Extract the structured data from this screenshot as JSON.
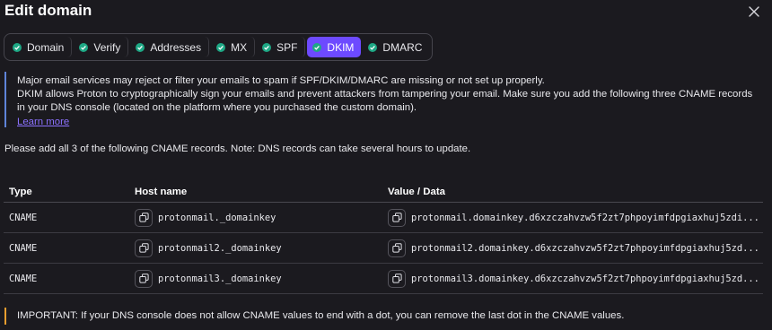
{
  "header": {
    "title": "Edit domain",
    "close_icon": "close-icon"
  },
  "tabs": [
    {
      "label": "Domain",
      "status": "verified",
      "active": false
    },
    {
      "label": "Verify",
      "status": "verified",
      "active": false
    },
    {
      "label": "Addresses",
      "status": "verified",
      "active": false
    },
    {
      "label": "MX",
      "status": "verified",
      "active": false
    },
    {
      "label": "SPF",
      "status": "verified",
      "active": false
    },
    {
      "label": "DKIM",
      "status": "verified",
      "active": true
    },
    {
      "label": "DMARC",
      "status": "verified",
      "active": false
    }
  ],
  "info": {
    "line1": "Major email services may reject or filter your emails to spam if SPF/DKIM/DMARC are missing or not set up properly.",
    "line2": "DKIM allows Proton to cryptographically sign your emails and prevent attackers from tampering your email. Make sure you add the following three CNAME records in your DNS console (located on the platform where you purchased the custom domain).",
    "link": "Learn more"
  },
  "note": "Please add all 3 of the following CNAME records. Note: DNS records can take several hours to update.",
  "table": {
    "headers": {
      "type": "Type",
      "host": "Host name",
      "value": "Value / Data"
    },
    "rows": [
      {
        "type": "CNAME",
        "host": "protonmail._domainkey",
        "value": "protonmail.domainkey.d6xzczahvzw5f2zt7phpoyimfdpgiaxhuj5zdi..."
      },
      {
        "type": "CNAME",
        "host": "protonmail2._domainkey",
        "value": "protonmail2.domainkey.d6xzczahvzw5f2zt7phpoyimfdpgiaxhuj5zd..."
      },
      {
        "type": "CNAME",
        "host": "protonmail3._domainkey",
        "value": "protonmail3.domainkey.d6xzczahvzw5f2zt7phpoyimfdpgiaxhuj5zd..."
      }
    ]
  },
  "important": "IMPORTANT: If your DNS console does not allow CNAME values to end with a dot, you can remove the last dot in the CNAME values.",
  "colors": {
    "accent": "#6d4aff",
    "success": "#1ea885",
    "info_border": "#5f84d9",
    "warning_border": "#e99e2f",
    "background": "#1b1a1f"
  }
}
